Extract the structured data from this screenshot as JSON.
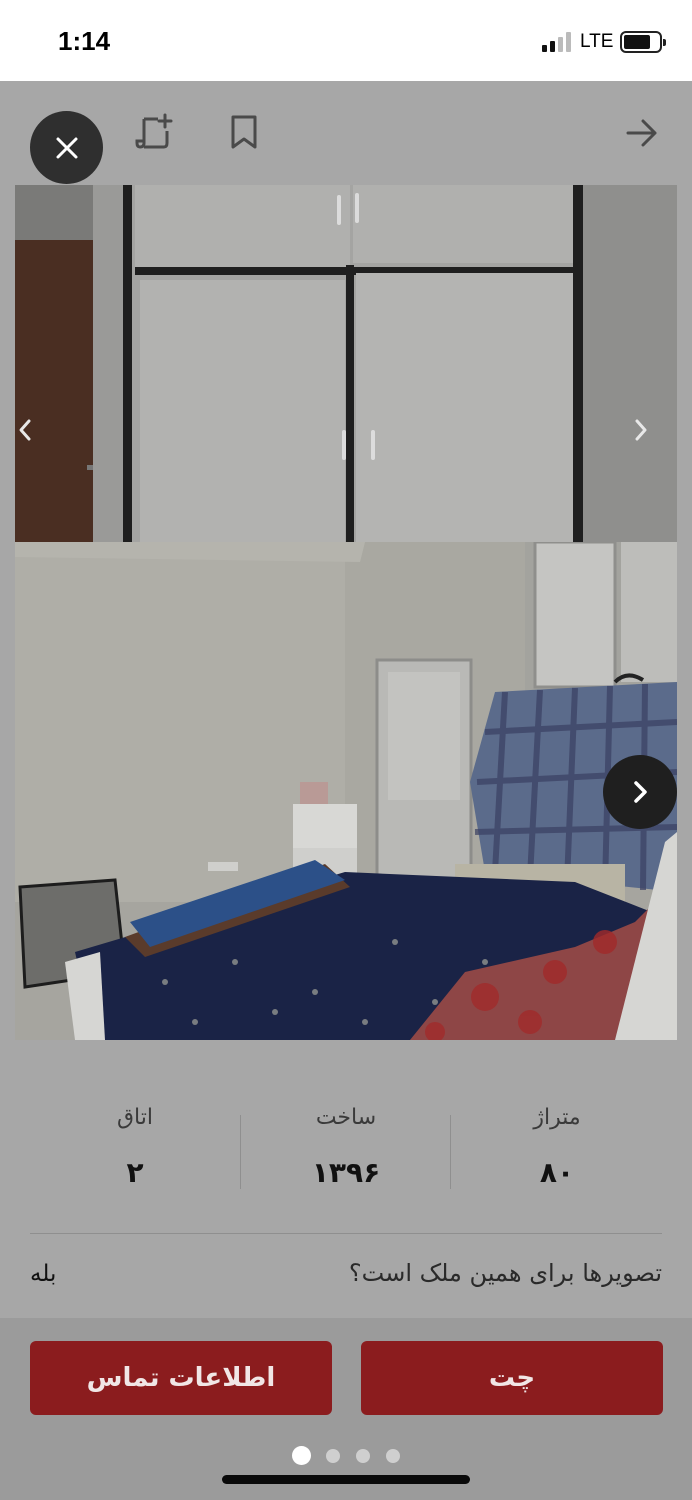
{
  "status_bar": {
    "time": "1:14",
    "network": "LTE"
  },
  "toolbar": {
    "close_icon": "close-icon",
    "add_note_icon": "add-note-icon",
    "bookmark_icon": "bookmark-icon",
    "back_icon": "arrow-right-icon"
  },
  "gallery": {
    "prev_icon": "chevron-left-icon",
    "next_icon": "chevron-right-icon",
    "page_count": 4,
    "active_page": 1
  },
  "specs": [
    {
      "label": "متراژ",
      "value": "۸۰"
    },
    {
      "label": "ساخت",
      "value": "۱۳۹۶"
    },
    {
      "label": "اتاق",
      "value": "۲"
    }
  ],
  "photo_question": {
    "text": "تصویرها برای همین ملک است؟",
    "answer": "بله"
  },
  "actions": {
    "contact_label": "اطلاعات تماس",
    "chat_label": "چت"
  },
  "colors": {
    "accent": "#8b1c1e",
    "overlay": "#a7a7a7"
  }
}
